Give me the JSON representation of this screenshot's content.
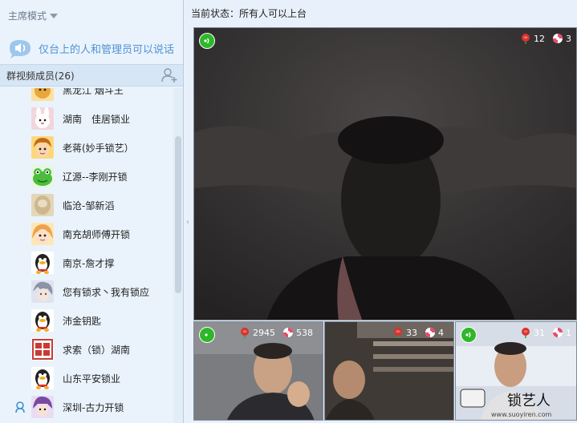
{
  "sidebar": {
    "mode_label": "主席模式",
    "notice": "仅台上的人和管理员可以说话",
    "members_title": "群视频成员(26)",
    "members": [
      {
        "name": "黑龙江 烟斗王",
        "avatar": "cartoon-face",
        "color": "#e8a73a",
        "role": ""
      },
      {
        "name": "湖南　佳居锁业",
        "avatar": "bunny",
        "color": "#f1d6dc",
        "role": ""
      },
      {
        "name": "老蒋(妙手锁艺）",
        "avatar": "cartoon-boy",
        "color": "#f2b13b",
        "role": ""
      },
      {
        "name": "辽源--李刚开锁",
        "avatar": "green-frog",
        "color": "#4bbd3c",
        "role": ""
      },
      {
        "name": "临沧-邹新滔",
        "avatar": "beige-photo",
        "color": "#cdb78e",
        "role": ""
      },
      {
        "name": "南充胡师傅开锁",
        "avatar": "cartoon-girl",
        "color": "#f0a24a",
        "role": ""
      },
      {
        "name": "南京-詹才撑",
        "avatar": "qq-penguin",
        "color": "#222222",
        "role": ""
      },
      {
        "name": "您有锁求丶我有锁应",
        "avatar": "anime-silver",
        "color": "#8b93a8",
        "role": ""
      },
      {
        "name": "沛金钥匙",
        "avatar": "qq-penguin",
        "color": "#222222",
        "role": ""
      },
      {
        "name": "求索（锁）湖南",
        "avatar": "seal-stamp",
        "color": "#c93a35",
        "role": ""
      },
      {
        "name": "山东平安锁业",
        "avatar": "qq-penguin",
        "color": "#222222",
        "role": ""
      },
      {
        "name": "深圳-古力开锁",
        "avatar": "anime-purple",
        "color": "#7a4aa3",
        "role": "admin"
      }
    ]
  },
  "main": {
    "status": "当前状态：所有人可以上台",
    "main_video": {
      "roses": "12",
      "candies": "3"
    },
    "small_videos": [
      {
        "roses": "2945",
        "candies": "538"
      },
      {
        "roses": "33",
        "candies": "4"
      },
      {
        "roses": "31",
        "candies": "1"
      }
    ]
  },
  "watermark": {
    "text": "锁艺人",
    "url": "www.suoyiren.com"
  },
  "colors": {
    "signal": "#2fb72a",
    "accent": "#4e92d4",
    "rose": "#d8322f",
    "candy": "#e94b6a"
  }
}
